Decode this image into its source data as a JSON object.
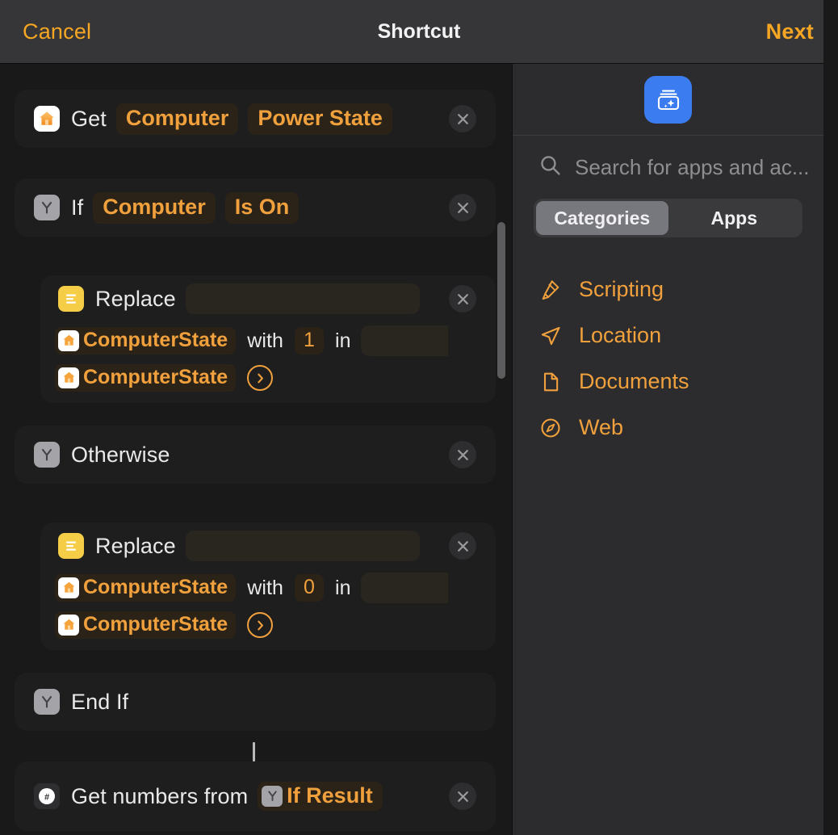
{
  "topbar": {
    "cancel_label": "Cancel",
    "title": "Shortcut",
    "next_label": "Next"
  },
  "colors": {
    "accent_orange": "#f0a03c",
    "token_bg": "#2b2318",
    "card_bg": "#1e1e1f",
    "page_bg": "#19191a",
    "panel_bg": "#2c2c2e",
    "app_icon_blue": "#3b7cf0",
    "replace_icon_yellow": "#f5cd47",
    "if_icon_gray": "#a3a3a8"
  },
  "editor": {
    "actions": [
      {
        "id": "get-power-state",
        "icon": "home-icon",
        "label": "Get",
        "tokens": [
          "Computer",
          "Power State"
        ],
        "delete_label": "×"
      },
      {
        "id": "if",
        "icon": "if-branch-icon",
        "label": "If",
        "tokens": [
          "Computer",
          "Is On"
        ],
        "delete_label": "×"
      },
      {
        "id": "replace-1",
        "icon": "text-lines-icon",
        "label": "Replace",
        "var_token": "ComputerState",
        "var_icon": "home-icon",
        "with_label": "with",
        "with_value": "1",
        "in_label": "in",
        "in_token": "ComputerState",
        "in_token_icon": "home-icon",
        "expand_label": "›",
        "delete_label": "×"
      },
      {
        "id": "otherwise",
        "icon": "if-branch-icon",
        "label": "Otherwise",
        "delete_label": "×"
      },
      {
        "id": "replace-2",
        "icon": "text-lines-icon",
        "label": "Replace",
        "var_token": "ComputerState",
        "var_icon": "home-icon",
        "with_label": "with",
        "with_value": "0",
        "in_label": "in",
        "in_token": "ComputerState",
        "in_token_icon": "home-icon",
        "expand_label": "›",
        "delete_label": "×"
      },
      {
        "id": "end-if",
        "icon": "if-branch-icon",
        "label": "End If"
      },
      {
        "id": "get-numbers",
        "icon": "hash-icon",
        "label": "Get numbers from",
        "token": "If Result",
        "token_icon": "if-branch-icon",
        "delete_label": "×"
      }
    ]
  },
  "library": {
    "app_icon_name": "shortcuts-gallery-icon",
    "search": {
      "icon": "search-icon",
      "placeholder": "Search for apps and ac...",
      "value": ""
    },
    "segmented": {
      "options": [
        "Categories",
        "Apps"
      ],
      "selected": "Categories"
    },
    "categories": [
      {
        "label": "Scripting",
        "icon": "ribbon-icon"
      },
      {
        "label": "Location",
        "icon": "paper-plane-icon"
      },
      {
        "label": "Documents",
        "icon": "document-icon"
      },
      {
        "label": "Web",
        "icon": "compass-icon"
      }
    ]
  }
}
